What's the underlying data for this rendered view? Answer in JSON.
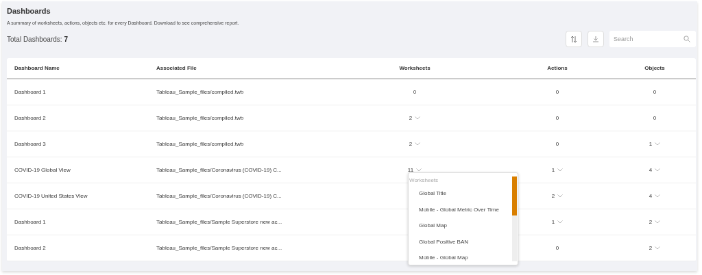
{
  "title": "Dashboards",
  "description": "A summary of worksheets, actions, objects etc. for every Dashboard. Download to see comprehensive report.",
  "total": {
    "label": "Total Dashboards:",
    "value": "7"
  },
  "search": {
    "placeholder": "Search"
  },
  "table": {
    "columns": [
      "Dashboard Name",
      "Associated File",
      "Worksheets",
      "Actions",
      "Objects"
    ],
    "rows": [
      {
        "name": "Dashboard 1",
        "file": "Tableau_Sample_files/compiled.twb",
        "worksheets": {
          "text": "0",
          "expandable": false
        },
        "actions": {
          "text": "0",
          "expandable": false
        },
        "objects": {
          "text": "0",
          "expandable": false
        }
      },
      {
        "name": "Dashboard 2",
        "file": "Tableau_Sample_files/compiled.twb",
        "worksheets": {
          "text": "2",
          "expandable": true
        },
        "actions": {
          "text": "0",
          "expandable": false
        },
        "objects": {
          "text": "0",
          "expandable": false
        }
      },
      {
        "name": "Dashboard 3",
        "file": "Tableau_Sample_files/compiled.twb",
        "worksheets": {
          "text": "2",
          "expandable": true
        },
        "actions": {
          "text": "0",
          "expandable": false
        },
        "objects": {
          "text": "1",
          "expandable": true
        }
      },
      {
        "name": "COVID-19 Global View",
        "file": "Tableau_Sample_files/Coronavirus (COVID-19) C...",
        "worksheets": {
          "text": "11",
          "expandable": true
        },
        "actions": {
          "text": "1",
          "expandable": true
        },
        "objects": {
          "text": "4",
          "expandable": true
        }
      },
      {
        "name": "COVID-19 United States View",
        "file": "Tableau_Sample_files/Coronavirus (COVID-19) C...",
        "actions": {
          "text": "2",
          "expandable": true
        },
        "objects": {
          "text": "4",
          "expandable": true
        }
      },
      {
        "name": "Dashboard 1",
        "file": "Tableau_Sample_files/Sample Superstore new ac...",
        "actions": {
          "text": "1",
          "expandable": true
        },
        "objects": {
          "text": "2",
          "expandable": true
        }
      },
      {
        "name": "Dashboard 2",
        "file": "Tableau_Sample_files/Sample Superstore new ac...",
        "actions": {
          "text": "0",
          "expandable": false
        },
        "objects": {
          "text": "2",
          "expandable": true
        }
      }
    ]
  },
  "popup": {
    "title": "Worksheets",
    "items": [
      "Global Title",
      "Mobile - Global Metric Over Time",
      "Global Map",
      "Global Positive BAN",
      "Mobile - Global Map"
    ]
  }
}
